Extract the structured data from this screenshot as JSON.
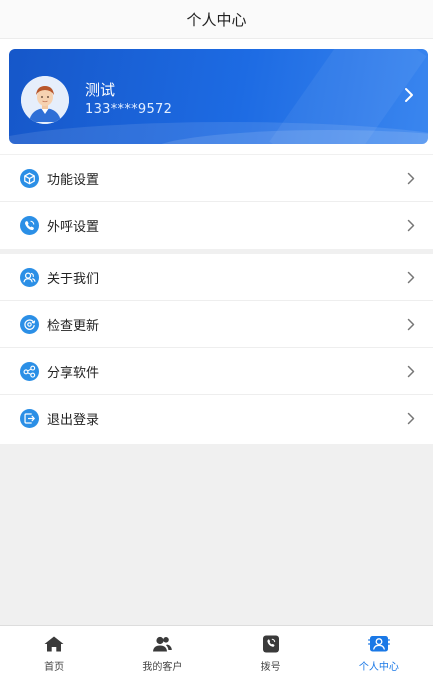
{
  "header": {
    "title": "个人中心"
  },
  "profile": {
    "name": "测试",
    "phone": "133****9572"
  },
  "menu_group1": [
    {
      "label": "功能设置",
      "icon": "settings-cube-icon"
    },
    {
      "label": "外呼设置",
      "icon": "phone-call-icon"
    }
  ],
  "menu_group2": [
    {
      "label": "关于我们",
      "icon": "users-icon"
    },
    {
      "label": "检查更新",
      "icon": "update-icon"
    },
    {
      "label": "分享软件",
      "icon": "share-icon"
    },
    {
      "label": "退出登录",
      "icon": "logout-icon"
    }
  ],
  "tabbar": [
    {
      "label": "首页",
      "icon": "home-icon",
      "active": false
    },
    {
      "label": "我的客户",
      "icon": "customers-icon",
      "active": false
    },
    {
      "label": "拨号",
      "icon": "dialer-icon",
      "active": false
    },
    {
      "label": "个人中心",
      "icon": "profile-icon",
      "active": true
    }
  ],
  "colors": {
    "accent": "#1a78e6",
    "card_start": "#1657c9",
    "card_end": "#3a86ef",
    "icon_blue": "#2b8fe6"
  }
}
